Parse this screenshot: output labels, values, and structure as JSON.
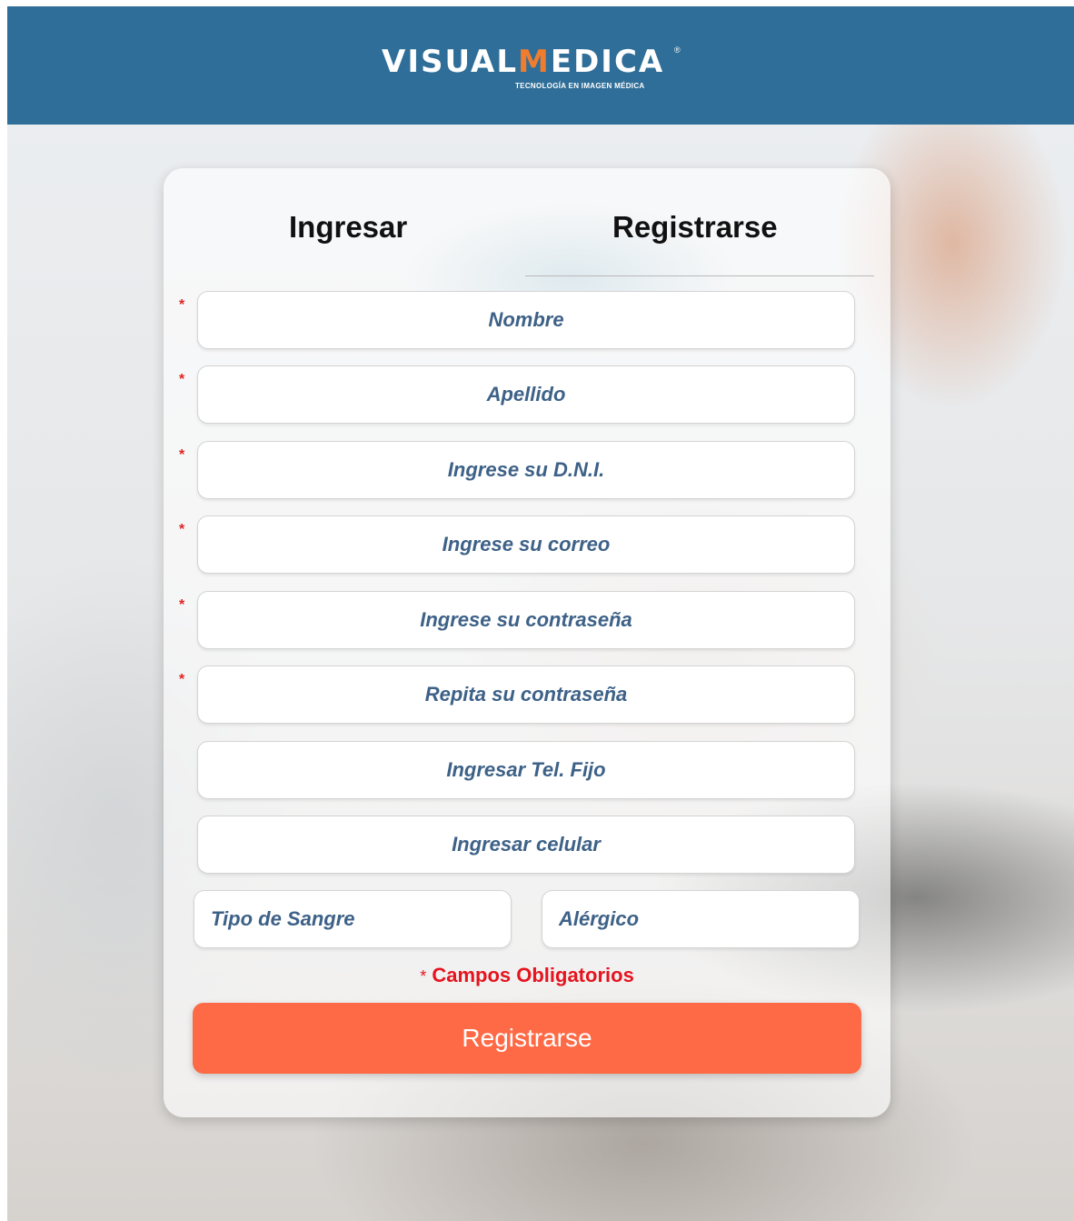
{
  "header": {
    "logo_left": "VISUAL",
    "logo_m": "M",
    "logo_right": "EDICA",
    "logo_registered": "®",
    "logo_tagline": "TECNOLOGÍA EN IMAGEN MÉDICA"
  },
  "tabs": {
    "login": "Ingresar",
    "register": "Registrarse"
  },
  "form": {
    "required_mark": "*",
    "fields": [
      {
        "placeholder": "Nombre",
        "required": true
      },
      {
        "placeholder": "Apellido",
        "required": true
      },
      {
        "placeholder": "Ingrese su D.N.I.",
        "required": true
      },
      {
        "placeholder": "Ingrese su correo",
        "required": true
      },
      {
        "placeholder": "Ingrese su contraseña",
        "required": true
      },
      {
        "placeholder": "Repita su contraseña",
        "required": true
      },
      {
        "placeholder": "Ingresar Tel. Fijo",
        "required": false
      },
      {
        "placeholder": "Ingresar celular",
        "required": false
      }
    ],
    "blood_type_placeholder": "Tipo de Sangre",
    "allergy_placeholder": "Alérgico",
    "required_note_star": "*",
    "required_note": "Campos Obligatorios",
    "submit_label": "Registrarse"
  },
  "colors": {
    "header_bg": "#2f6e98",
    "accent": "#ff6a46",
    "placeholder_text": "#3d6187",
    "required": "#e5141e"
  }
}
